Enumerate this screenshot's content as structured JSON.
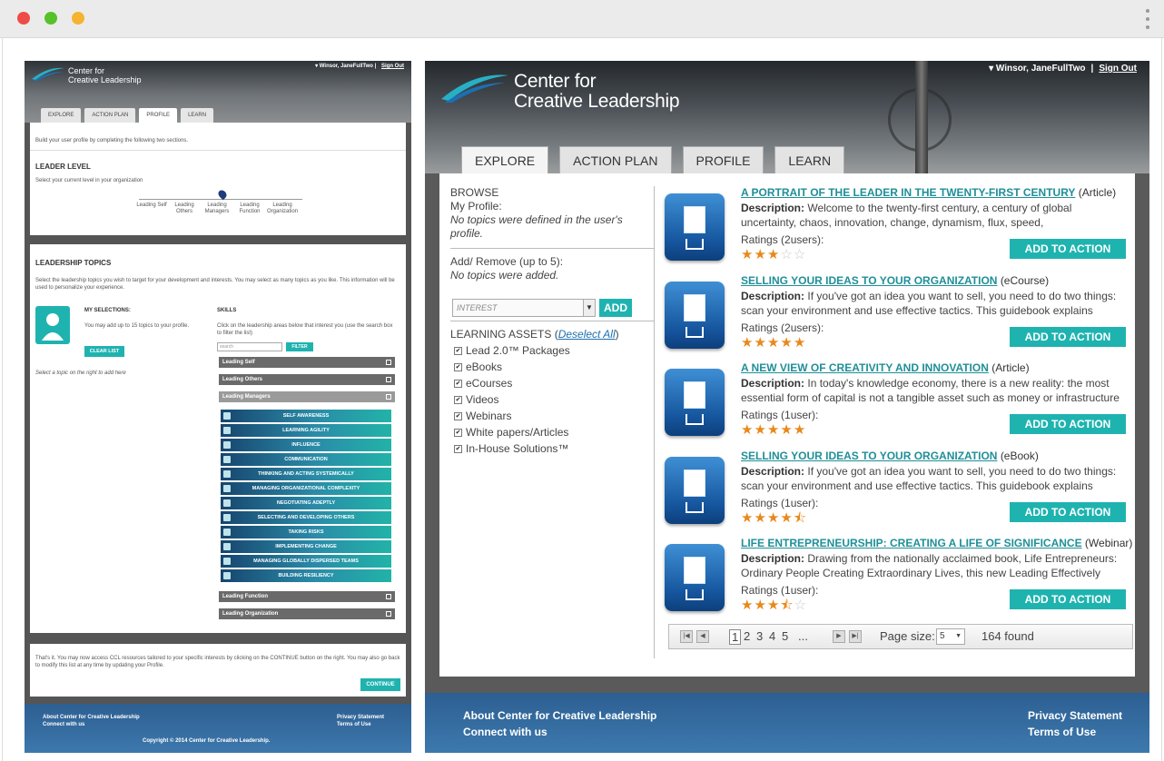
{
  "left": {
    "user": "Winsor, JaneFullTwo",
    "sign_out": "Sign Out",
    "logo": [
      "Center for",
      "Creative Leadership"
    ],
    "tabs": [
      "EXPLORE",
      "ACTION PLAN",
      "PROFILE",
      "LEARN"
    ],
    "intro": "Build your user profile by completing the following two sections.",
    "leader_level_title": "LEADER LEVEL",
    "leader_level_help": "Select your current level in your organization",
    "levels": [
      "Leading Self",
      "Leading Others",
      "Leading Managers",
      "Leading Function",
      "Leading Organization"
    ],
    "topics_title": "LEADERSHIP TOPICS",
    "topics_help": "Select the leadership topics you wish to target for your development and interests. You may select as many topics as you like. This information will be used to personalize your experience.",
    "my_selections": "MY SELECTIONS:",
    "selections_help": "You may add up to 15 topics to your profile.",
    "clear_list": "CLEAR LIST",
    "select_hint": "Select a topic on the right to add here",
    "skills": "SKILLS",
    "skills_help": "Click on the leadership areas below that interest you (use the search box to filter the list)",
    "search_placeholder": "search",
    "filter": "FILTER",
    "sections_top": [
      "Leading Self",
      "Leading Others",
      "Leading Managers"
    ],
    "skills_list": [
      "SELF AWARENESS",
      "LEARNING AGILITY",
      "INFLUENCE",
      "COMMUNICATION",
      "THINKING AND ACTING SYSTEMICALLY",
      "MANAGING ORGANIZATIONAL COMPLEXITY",
      "NEGOTIATING ADEPTLY",
      "SELECTING AND DEVELOPING OTHERS",
      "TAKING RISKS",
      "IMPLEMENTING CHANGE",
      "MANAGING GLOBALLY DISPERSED TEAMS",
      "BUILDING RESILIENCY"
    ],
    "sections_bottom": [
      "Leading Function",
      "Leading Organization"
    ],
    "bottom_text": "That's it. You may now access CCL resources tailored to your specific interests by clicking on the CONTINUE button on the right. You may also go back to modify this list at any time by updating your Profile.",
    "continue": "CONTINUE",
    "footer_about": "About Center for Creative Leadership",
    "footer_connect": "Connect with us",
    "footer_privacy": "Privacy Statement",
    "footer_terms": "Terms of Use",
    "copyright": "Copyright © 2014 Center for Creative Leadership."
  },
  "right": {
    "user": "Winsor, JaneFullTwo",
    "sign_out": "Sign Out",
    "logo": [
      "Center for",
      "Creative Leadership"
    ],
    "tabs": [
      "EXPLORE",
      "ACTION PLAN",
      "PROFILE",
      "LEARN"
    ],
    "browse": "BROWSE",
    "my_profile": "My Profile:",
    "no_topics_profile": "No topics were defined in the user's profile.",
    "add_remove": "Add/ Remove (up to 5):",
    "no_topics_added": "No topics were added.",
    "interest_placeholder": "INTEREST",
    "add": "ADD",
    "assets_label": "LEARNING ASSETS (",
    "deselect_all": "Deselect All",
    "assets_close": ")",
    "assets": [
      "Lead 2.0™ Packages",
      "eBooks",
      "eCourses",
      "Videos",
      "Webinars",
      "White papers/Articles",
      "In-House Solutions™"
    ],
    "items": [
      {
        "title": "A PORTRAIT OF THE LEADER IN THE TWENTY-FIRST CENTURY",
        "type": "(Article)",
        "desc_label": "Description:",
        "desc": "Welcome to the twenty-first century, a century of global uncertainty, chaos, innovation, change, dynamism, flux, speed,",
        "ratings": "Ratings (2users):",
        "stars": 3,
        "button": "ADD TO ACTION PLAN",
        "icon": "document-icon"
      },
      {
        "title": "SELLING YOUR IDEAS TO YOUR ORGANIZATION",
        "type": "(eCourse)",
        "desc_label": "Description:",
        "desc": "If you've got an idea you want to sell, you need to do two things: scan your environment and use effective tactics. This guidebook explains",
        "ratings": "Ratings (2users):",
        "stars": 5,
        "button": "ADD TO ACTION PLAN",
        "icon": "graduation-monitor-icon"
      },
      {
        "title": "A NEW VIEW OF CREATIVITY AND INNOVATION",
        "type": "(Article)",
        "desc_label": "Description:",
        "desc": "In today's knowledge economy, there is a new reality: the most essential form of capital is not a tangible asset such as money or infrastructure",
        "ratings": "Ratings (1user):",
        "stars": 5,
        "button": "ADD TO ACTION PLAN",
        "icon": "document-icon"
      },
      {
        "title": "SELLING YOUR IDEAS TO YOUR ORGANIZATION",
        "type": "(eBook)",
        "desc_label": "Description:",
        "desc": "If you've got an idea you want to sell, you need to do two things: scan your environment and use effective tactics. This guidebook explains",
        "ratings": "Ratings (1user):",
        "stars": 4.5,
        "button": "ADD TO ACTION PLAN",
        "icon": "ebook-icon"
      },
      {
        "title": "LIFE ENTREPRENEURSHIP: CREATING A LIFE OF SIGNIFICANCE",
        "type": "(Webinar)",
        "desc_label": "Description:",
        "desc": "Drawing from the nationally acclaimed book, Life Entrepreneurs: Ordinary People Creating Extraordinary Lives, this new Leading Effectively",
        "ratings": "Ratings (1user):",
        "stars": 3.5,
        "button": "ADD TO ACTION PLAN",
        "icon": "webinar-monitor-icon"
      }
    ],
    "pages": [
      "1",
      "2",
      "3",
      "4",
      "5",
      "..."
    ],
    "page_size_label": "Page size:",
    "page_size": "5",
    "found": "164 found",
    "footer_about": "About Center for Creative Leadership",
    "footer_connect": "Connect with us",
    "footer_privacy": "Privacy Statement",
    "footer_terms": "Terms of Use"
  },
  "colors": {
    "teal": "#1fb3b0",
    "link": "#1f8f98",
    "star": "#e8891b",
    "footer": "#3369a0"
  }
}
